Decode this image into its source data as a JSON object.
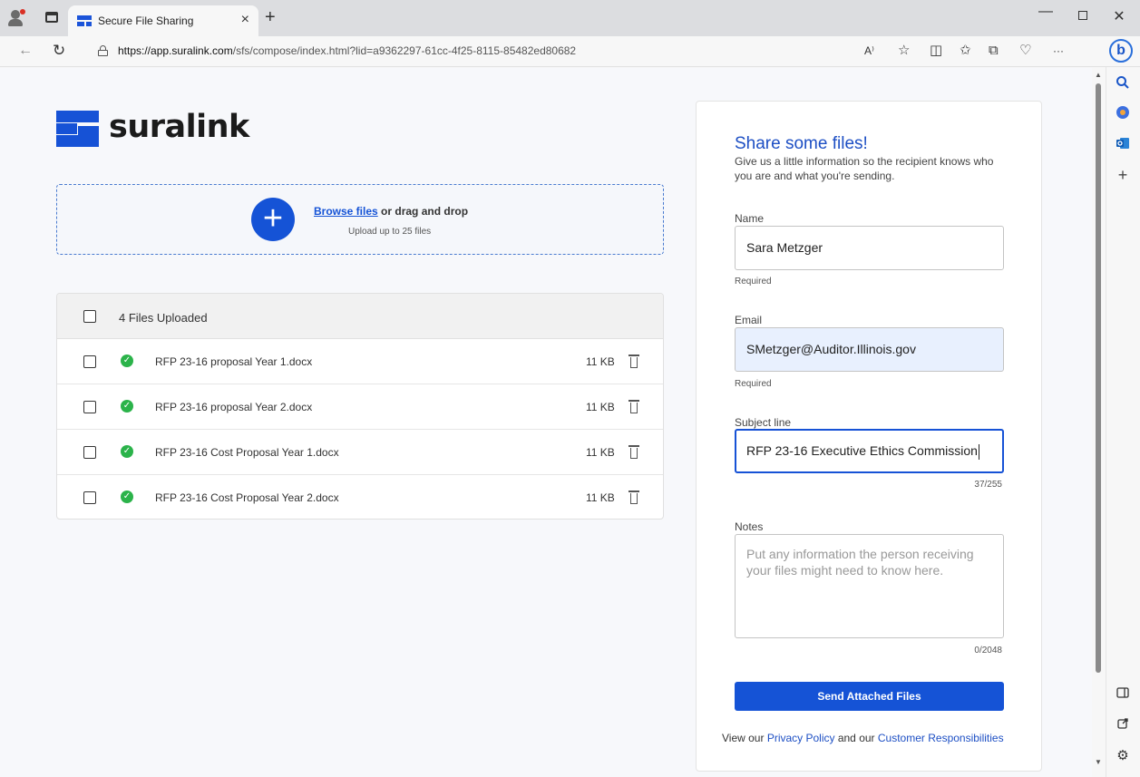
{
  "browser": {
    "tab_title": "Secure File Sharing",
    "tab_close": "×",
    "new_tab": "+",
    "url_host": "https://app.suralink.com",
    "url_path": "/sfs/compose/index.html?lid=a9362297-61cc-4f25-8115-85482ed80682",
    "icons": [
      "profile-icon",
      "workspaces-icon",
      "back-icon",
      "reload-icon",
      "lock-icon",
      "read-aloud-icon",
      "favorite-icon",
      "split-screen-icon",
      "favorites-icon",
      "collections-icon",
      "browser-essentials-icon",
      "more-icon",
      "copilot-icon"
    ],
    "toolbar_glyphs": {
      "read_aloud": "A⁾",
      "favorite": "☆",
      "split": "◫",
      "favorites": "✩",
      "collections": "⧉",
      "essentials": "♡",
      "more": "···",
      "copilot": "b"
    },
    "sidebar_icons": [
      "search-icon",
      "copilot-sidebar-icon",
      "outlook-icon",
      "add-icon",
      "sidebar-toggle-icon",
      "external-link-icon",
      "settings-icon"
    ]
  },
  "page": {
    "logo_text": "suralink",
    "dropzone": {
      "browse_label": "Browse files",
      "drag_label": " or drag and drop",
      "limit_text": "Upload up to 25 files"
    },
    "files": {
      "header": "4 Files Uploaded",
      "rows": [
        {
          "name": "RFP 23-16 proposal Year 1.docx",
          "size": "11 KB"
        },
        {
          "name": "RFP 23-16 proposal Year 2.docx",
          "size": "11 KB"
        },
        {
          "name": "RFP 23-16 Cost Proposal Year 1.docx",
          "size": "11 KB"
        },
        {
          "name": "RFP 23-16 Cost Proposal Year 2.docx",
          "size": "11 KB"
        }
      ]
    }
  },
  "form": {
    "title": "Share some files!",
    "description": "Give us a little information so the recipient knows who you are and what you're sending.",
    "name_label": "Name",
    "name_value": "Sara Metzger",
    "name_helper": "Required",
    "email_label": "Email",
    "email_value": "SMetzger@Auditor.Illinois.gov",
    "email_helper": "Required",
    "subject_label": "Subject line",
    "subject_value": "RFP 23-16 Executive Ethics Commission",
    "subject_counter": "37/255",
    "notes_label": "Notes",
    "notes_placeholder": "Put any information the person receiving your files might need to know here.",
    "notes_counter": "0/2048",
    "send_label": "Send Attached Files",
    "footer_prefix": "View our ",
    "privacy_link": "Privacy Policy",
    "footer_middle": " and our ",
    "responsibilities_link": "Customer Responsibilities"
  },
  "colors": {
    "brand_blue": "#1553d6",
    "success_green": "#2bb34a",
    "title_blue": "#1d4fc4"
  }
}
